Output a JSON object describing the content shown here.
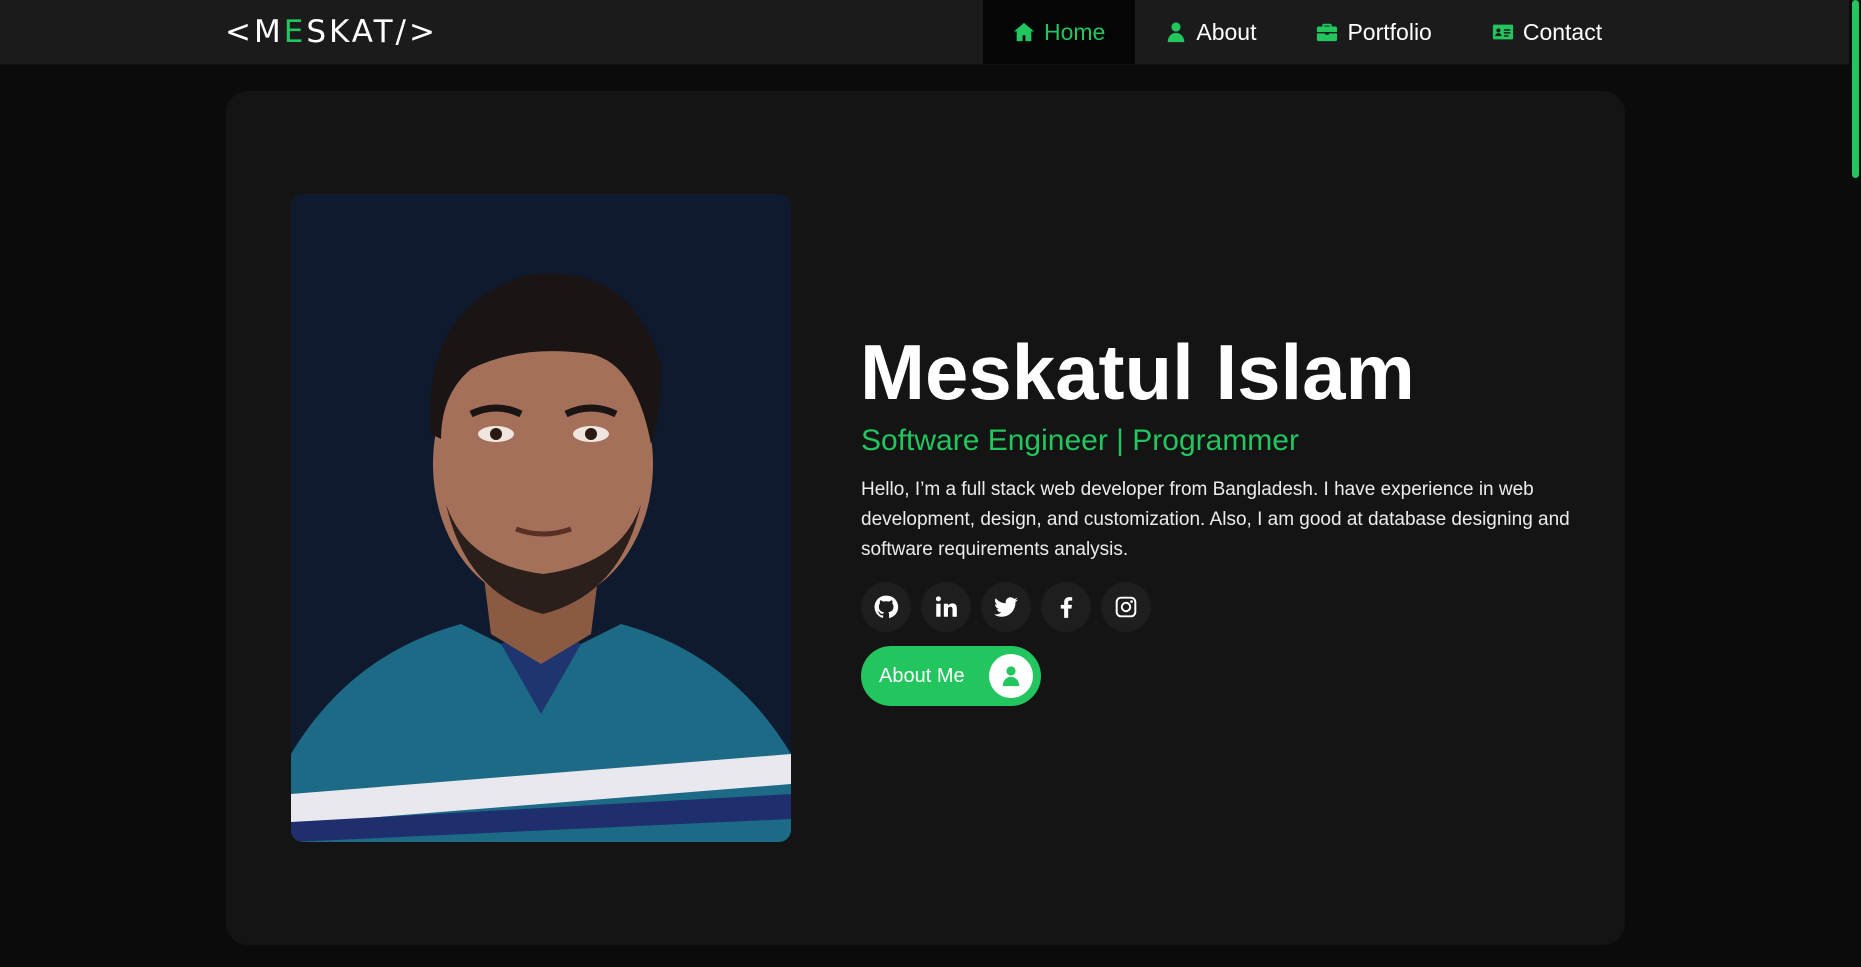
{
  "brand": {
    "logo_prefix": "<M",
    "logo_accent": "E",
    "logo_suffix": "SKAT/>"
  },
  "nav": {
    "items": [
      {
        "label": "Home",
        "icon": "home-icon",
        "active": true
      },
      {
        "label": "About",
        "icon": "user-icon",
        "active": false
      },
      {
        "label": "Portfolio",
        "icon": "briefcase-icon",
        "active": false
      },
      {
        "label": "Contact",
        "icon": "id-card-icon",
        "active": false
      }
    ]
  },
  "hero": {
    "name": "Meskatul Islam",
    "role": "Software Engineer | Programmer",
    "bio": "Hello, I’m a full stack web developer from Bangladesh. I have experience in web development, design, and customization. Also, I am good at database designing and software requirements analysis.",
    "socials": [
      {
        "icon": "github-icon"
      },
      {
        "icon": "linkedin-icon"
      },
      {
        "icon": "twitter-icon"
      },
      {
        "icon": "facebook-icon"
      },
      {
        "icon": "instagram-icon"
      }
    ],
    "cta_label": "About Me",
    "cta_icon": "user-icon"
  },
  "colors": {
    "accent": "#22c55e",
    "background": "#0b0b0b",
    "navbar": "#1b1b1b",
    "card": "#141414",
    "photo_background": "#0f1a2e"
  }
}
